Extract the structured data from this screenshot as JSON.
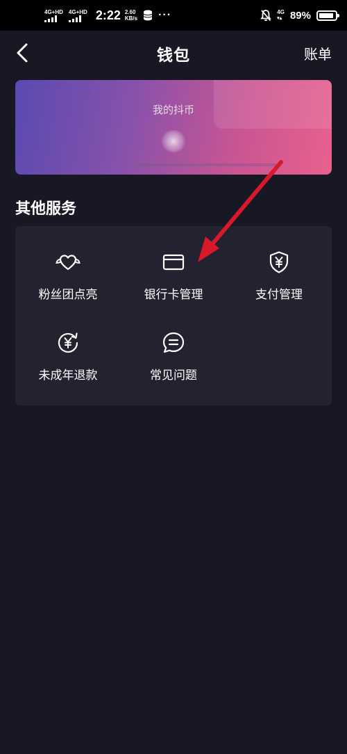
{
  "status_bar": {
    "sim1_label": "4G+HD",
    "sim2_label": "4G+HD",
    "time": "2:22",
    "speed_value": "2.60",
    "speed_unit": "KB/s",
    "more": "···",
    "net_label": "4G",
    "battery_percent": "89%",
    "battery_level": 0.89
  },
  "nav": {
    "title": "钱包",
    "right_action": "账单"
  },
  "coin_card": {
    "label": "我的抖币"
  },
  "section": {
    "title": "其他服务"
  },
  "services": [
    {
      "label": "粉丝团点亮",
      "icon": "heart-wings-icon"
    },
    {
      "label": "银行卡管理",
      "icon": "card-icon"
    },
    {
      "label": "支付管理",
      "icon": "shield-yuan-icon"
    },
    {
      "label": "未成年退款",
      "icon": "refund-yuan-icon"
    },
    {
      "label": "常见问题",
      "icon": "chat-bubble-icon"
    }
  ],
  "colors": {
    "background": "#181824",
    "panel": "#222230",
    "card_gradient_start": "#5a4ab0",
    "card_gradient_end": "#e8618d",
    "annotation_arrow": "#d7192b"
  }
}
